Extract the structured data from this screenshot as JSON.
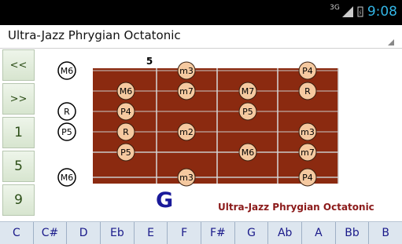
{
  "status": {
    "network": "3G",
    "time": "9:08"
  },
  "title": "Ultra-Jazz Phrygian Octatonic",
  "left_buttons": [
    "<<",
    ">>",
    "1",
    "5",
    "9"
  ],
  "fret_number": "5",
  "open_markers": [
    "M6",
    "R",
    "P5",
    "M6"
  ],
  "note_dots": [
    {
      "string": 0,
      "fret": 1,
      "label": "m3"
    },
    {
      "string": 0,
      "fret": 4,
      "label": "P4"
    },
    {
      "string": 1,
      "fret": 0,
      "label": "M6"
    },
    {
      "string": 1,
      "fret": 1,
      "label": "m7"
    },
    {
      "string": 1,
      "fret": 2,
      "label": "M7"
    },
    {
      "string": 1,
      "fret": 4,
      "label": "R"
    },
    {
      "string": 2,
      "fret": 0,
      "label": "P4"
    },
    {
      "string": 2,
      "fret": 2,
      "label": "P5"
    },
    {
      "string": 3,
      "fret": 0,
      "label": "R"
    },
    {
      "string": 3,
      "fret": 1,
      "label": "m2"
    },
    {
      "string": 3,
      "fret": 4,
      "label": "m3"
    },
    {
      "string": 4,
      "fret": 0,
      "label": "P5"
    },
    {
      "string": 4,
      "fret": 2,
      "label": "M6"
    },
    {
      "string": 4,
      "fret": 4,
      "label": "m7"
    },
    {
      "string": 5,
      "fret": 1,
      "label": "m3"
    },
    {
      "string": 5,
      "fret": 4,
      "label": "P4"
    }
  ],
  "key_note": "G",
  "scale_label": "Ultra-Jazz Phrygian Octatonic",
  "keys": [
    "C",
    "C#",
    "D",
    "Eb",
    "E",
    "F",
    "F#",
    "G",
    "Ab",
    "A",
    "Bb",
    "B"
  ],
  "colors": {
    "board": "#8b2a10",
    "dot_fill": "#f5c9a0",
    "accent": "#33b5e5"
  }
}
